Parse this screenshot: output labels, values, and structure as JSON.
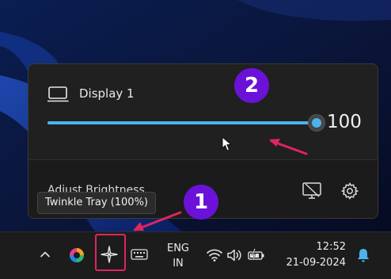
{
  "display": {
    "name": "Display 1",
    "brightness": 100,
    "brightness_text": "100"
  },
  "flyout_footer": {
    "label": "Adjust Brightness"
  },
  "tooltip": {
    "text": "Twinkle Tray (100%)"
  },
  "taskbar": {
    "language_line1": "ENG",
    "language_line2": "IN",
    "time": "12:52",
    "date": "21-09-2024",
    "icons": [
      "chevron-up-icon",
      "copilot-icon",
      "twinkle-tray-icon",
      "keyboard-icon",
      "wifi-icon",
      "volume-icon",
      "battery-icon",
      "notification-bell-icon"
    ]
  },
  "annotations": {
    "badge_1": "1",
    "badge_2": "2",
    "accent_color": "#e0245e",
    "badge_color": "#6b12d9"
  },
  "colors": {
    "slider_accent": "#4bb3e8",
    "flyout_bg": "#202020",
    "taskbar_bg": "#1c1c1c"
  }
}
